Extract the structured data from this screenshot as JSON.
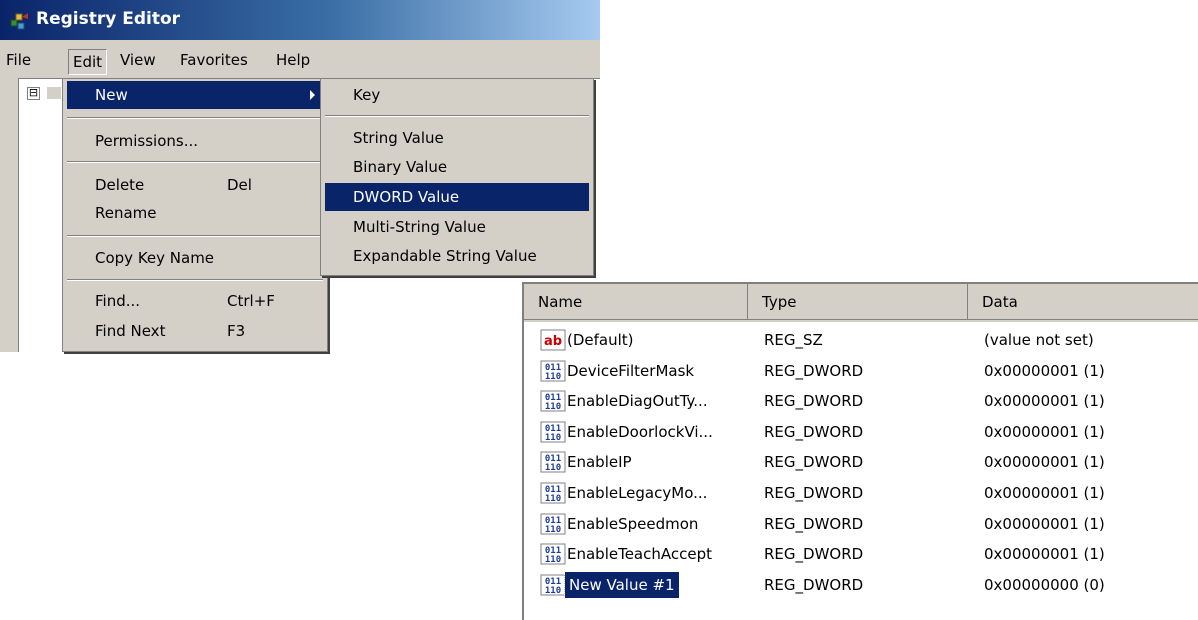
{
  "window": {
    "title": "Registry Editor",
    "app_icon": "registry-editor-icon"
  },
  "menubar": {
    "items": [
      "File",
      "Edit",
      "View",
      "Favorites",
      "Help"
    ],
    "active": "Edit"
  },
  "tree": {
    "expander": "⊟"
  },
  "edit_menu": {
    "new": "New",
    "permissions": "Permissions...",
    "delete": "Delete",
    "delete_shortcut": "Del",
    "rename": "Rename",
    "copy_key_name": "Copy Key Name",
    "find": "Find...",
    "find_shortcut": "Ctrl+F",
    "find_next": "Find Next",
    "find_next_shortcut": "F3"
  },
  "new_submenu": {
    "key": "Key",
    "string_value": "String Value",
    "binary_value": "Binary Value",
    "dword_value": "DWORD Value",
    "multi_string_value": "Multi-String Value",
    "expandable_string_value": "Expandable String Value",
    "highlighted": "DWORD Value"
  },
  "values_list": {
    "columns": [
      "Name",
      "Type",
      "Data"
    ],
    "rows": [
      {
        "icon": "string-value-icon",
        "name": "(Default)",
        "type": "REG_SZ",
        "data": "(value not set)"
      },
      {
        "icon": "binary-value-icon",
        "name": "DeviceFilterMask",
        "type": "REG_DWORD",
        "data": "0x00000001 (1)"
      },
      {
        "icon": "binary-value-icon",
        "name": "EnableDiagOutTy...",
        "type": "REG_DWORD",
        "data": "0x00000001 (1)"
      },
      {
        "icon": "binary-value-icon",
        "name": "EnableDoorlockVi...",
        "type": "REG_DWORD",
        "data": "0x00000001 (1)"
      },
      {
        "icon": "binary-value-icon",
        "name": "EnableIP",
        "type": "REG_DWORD",
        "data": "0x00000001 (1)"
      },
      {
        "icon": "binary-value-icon",
        "name": "EnableLegacyMo...",
        "type": "REG_DWORD",
        "data": "0x00000001 (1)"
      },
      {
        "icon": "binary-value-icon",
        "name": "EnableSpeedmon",
        "type": "REG_DWORD",
        "data": "0x00000001 (1)"
      },
      {
        "icon": "binary-value-icon",
        "name": "EnableTeachAccept",
        "type": "REG_DWORD",
        "data": "0x00000001 (1)"
      },
      {
        "icon": "binary-value-icon",
        "name": "New Value #1",
        "type": "REG_DWORD",
        "data": "0x00000000 (0)",
        "selected": true
      }
    ]
  },
  "colors": {
    "highlight": "#0a246a",
    "face": "#d4d0c8",
    "string_icon": "#cc0000",
    "binary_icon": "#1e3c96"
  }
}
